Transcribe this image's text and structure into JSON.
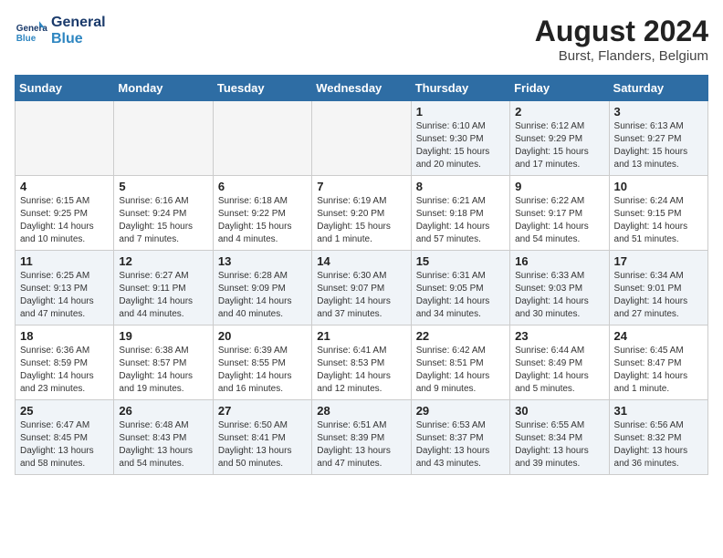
{
  "header": {
    "logo_line1": "General",
    "logo_line2": "Blue",
    "month_year": "August 2024",
    "location": "Burst, Flanders, Belgium"
  },
  "weekdays": [
    "Sunday",
    "Monday",
    "Tuesday",
    "Wednesday",
    "Thursday",
    "Friday",
    "Saturday"
  ],
  "weeks": [
    [
      {
        "day": "",
        "empty": true
      },
      {
        "day": "",
        "empty": true
      },
      {
        "day": "",
        "empty": true
      },
      {
        "day": "",
        "empty": true
      },
      {
        "day": "1",
        "sunrise": "6:10 AM",
        "sunset": "9:30 PM",
        "daylight": "15 hours and 20 minutes."
      },
      {
        "day": "2",
        "sunrise": "6:12 AM",
        "sunset": "9:29 PM",
        "daylight": "15 hours and 17 minutes."
      },
      {
        "day": "3",
        "sunrise": "6:13 AM",
        "sunset": "9:27 PM",
        "daylight": "15 hours and 13 minutes."
      }
    ],
    [
      {
        "day": "4",
        "sunrise": "6:15 AM",
        "sunset": "9:25 PM",
        "daylight": "14 hours and 10 minutes."
      },
      {
        "day": "5",
        "sunrise": "6:16 AM",
        "sunset": "9:24 PM",
        "daylight": "15 hours and 7 minutes."
      },
      {
        "day": "6",
        "sunrise": "6:18 AM",
        "sunset": "9:22 PM",
        "daylight": "15 hours and 4 minutes."
      },
      {
        "day": "7",
        "sunrise": "6:19 AM",
        "sunset": "9:20 PM",
        "daylight": "15 hours and 1 minute."
      },
      {
        "day": "8",
        "sunrise": "6:21 AM",
        "sunset": "9:18 PM",
        "daylight": "14 hours and 57 minutes."
      },
      {
        "day": "9",
        "sunrise": "6:22 AM",
        "sunset": "9:17 PM",
        "daylight": "14 hours and 54 minutes."
      },
      {
        "day": "10",
        "sunrise": "6:24 AM",
        "sunset": "9:15 PM",
        "daylight": "14 hours and 51 minutes."
      }
    ],
    [
      {
        "day": "11",
        "sunrise": "6:25 AM",
        "sunset": "9:13 PM",
        "daylight": "14 hours and 47 minutes."
      },
      {
        "day": "12",
        "sunrise": "6:27 AM",
        "sunset": "9:11 PM",
        "daylight": "14 hours and 44 minutes."
      },
      {
        "day": "13",
        "sunrise": "6:28 AM",
        "sunset": "9:09 PM",
        "daylight": "14 hours and 40 minutes."
      },
      {
        "day": "14",
        "sunrise": "6:30 AM",
        "sunset": "9:07 PM",
        "daylight": "14 hours and 37 minutes."
      },
      {
        "day": "15",
        "sunrise": "6:31 AM",
        "sunset": "9:05 PM",
        "daylight": "14 hours and 34 minutes."
      },
      {
        "day": "16",
        "sunrise": "6:33 AM",
        "sunset": "9:03 PM",
        "daylight": "14 hours and 30 minutes."
      },
      {
        "day": "17",
        "sunrise": "6:34 AM",
        "sunset": "9:01 PM",
        "daylight": "14 hours and 27 minutes."
      }
    ],
    [
      {
        "day": "18",
        "sunrise": "6:36 AM",
        "sunset": "8:59 PM",
        "daylight": "14 hours and 23 minutes."
      },
      {
        "day": "19",
        "sunrise": "6:38 AM",
        "sunset": "8:57 PM",
        "daylight": "14 hours and 19 minutes."
      },
      {
        "day": "20",
        "sunrise": "6:39 AM",
        "sunset": "8:55 PM",
        "daylight": "14 hours and 16 minutes."
      },
      {
        "day": "21",
        "sunrise": "6:41 AM",
        "sunset": "8:53 PM",
        "daylight": "14 hours and 12 minutes."
      },
      {
        "day": "22",
        "sunrise": "6:42 AM",
        "sunset": "8:51 PM",
        "daylight": "14 hours and 9 minutes."
      },
      {
        "day": "23",
        "sunrise": "6:44 AM",
        "sunset": "8:49 PM",
        "daylight": "14 hours and 5 minutes."
      },
      {
        "day": "24",
        "sunrise": "6:45 AM",
        "sunset": "8:47 PM",
        "daylight": "14 hours and 1 minute."
      }
    ],
    [
      {
        "day": "25",
        "sunrise": "6:47 AM",
        "sunset": "8:45 PM",
        "daylight": "13 hours and 58 minutes."
      },
      {
        "day": "26",
        "sunrise": "6:48 AM",
        "sunset": "8:43 PM",
        "daylight": "13 hours and 54 minutes."
      },
      {
        "day": "27",
        "sunrise": "6:50 AM",
        "sunset": "8:41 PM",
        "daylight": "13 hours and 50 minutes."
      },
      {
        "day": "28",
        "sunrise": "6:51 AM",
        "sunset": "8:39 PM",
        "daylight": "13 hours and 47 minutes."
      },
      {
        "day": "29",
        "sunrise": "6:53 AM",
        "sunset": "8:37 PM",
        "daylight": "13 hours and 43 minutes."
      },
      {
        "day": "30",
        "sunrise": "6:55 AM",
        "sunset": "8:34 PM",
        "daylight": "13 hours and 39 minutes."
      },
      {
        "day": "31",
        "sunrise": "6:56 AM",
        "sunset": "8:32 PM",
        "daylight": "13 hours and 36 minutes."
      }
    ]
  ]
}
